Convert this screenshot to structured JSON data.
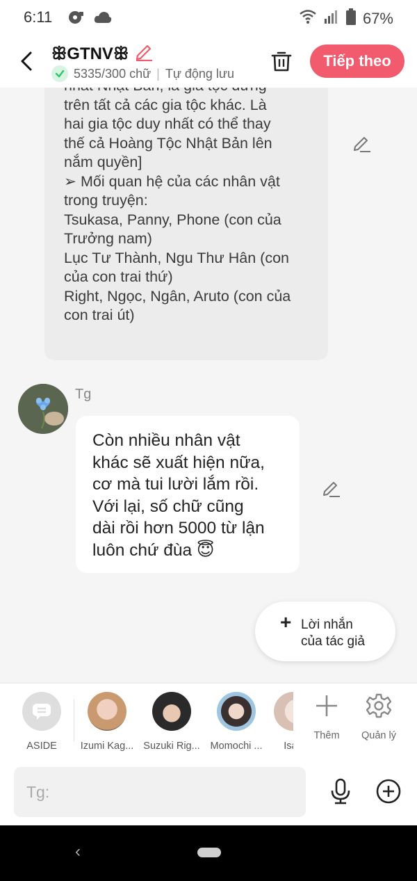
{
  "status_bar": {
    "time": "6:11",
    "battery": "67%"
  },
  "header": {
    "title": "ꕥGTNVꕥ",
    "word_count": "5335/300 chữ",
    "separator": "|",
    "autosave": "Tự động lưu",
    "next_label": "Tiếp theo"
  },
  "messages": [
    {
      "lines": [
        "nhất Nhật Bản, là gia tộc đứng",
        "trên tất cả các gia tộc khác. Là",
        "hai gia tộc duy nhất có thể thay",
        "thế cả Hoàng Tộc Nhật Bản lên",
        "nắm quyền]",
        "➢ Mối quan hệ của các nhân vật",
        "trong truyện:",
        "Tsukasa, Panny, Phone (con của",
        "Trưởng nam)",
        "Lục Tư Thành, Ngu Thư Hân (con",
        "của con trai thứ)",
        "Right, Ngọc, Ngân, Aruto (con của",
        "con trai út)"
      ]
    },
    {
      "sender": "Tg",
      "lines": [
        "Còn nhiều nhân vật",
        "khác sẽ xuất hiện nữa,",
        "cơ mà tui lười lắm rồi.",
        "Với lại, số chữ cũng",
        "dài rồi hơn 5000 từ lận",
        "luôn chứ đùa 😇"
      ]
    }
  ],
  "author_note": {
    "plus": "+",
    "line1": "Lời nhắn",
    "line2": "của tác giả"
  },
  "characters": [
    {
      "label": "ASIDE"
    },
    {
      "label": "Izumi Kag..."
    },
    {
      "label": "Suzuki Rig..."
    },
    {
      "label": "Momochi ..."
    },
    {
      "label": "Isag"
    }
  ],
  "tools": {
    "add_label": "Thêm",
    "manage_label": "Quản lý"
  },
  "input": {
    "placeholder": "Tg:"
  },
  "colors": {
    "accent": "#f25a6e",
    "check_green": "#33c46a"
  }
}
